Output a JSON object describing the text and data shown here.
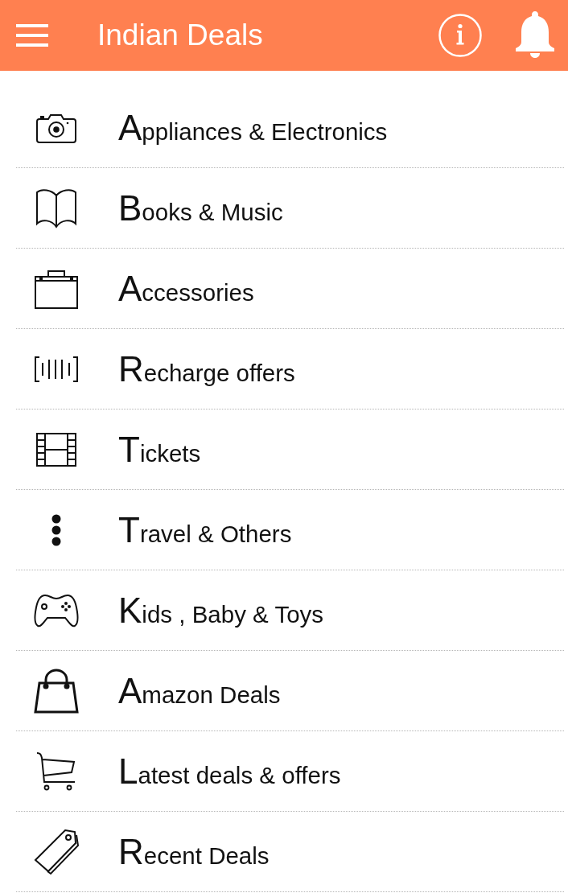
{
  "app_bar": {
    "title": "Indian Deals"
  },
  "categories": [
    {
      "label": "Appliances & Electronics"
    },
    {
      "label": "Books & Music"
    },
    {
      "label": "Accessories"
    },
    {
      "label": "Recharge offers"
    },
    {
      "label": "Tickets"
    },
    {
      "label": "Travel & Others"
    },
    {
      "label": "Kids , Baby & Toys"
    },
    {
      "label": "Amazon Deals"
    },
    {
      "label": "Latest deals & offers"
    },
    {
      "label": "Recent Deals"
    }
  ]
}
